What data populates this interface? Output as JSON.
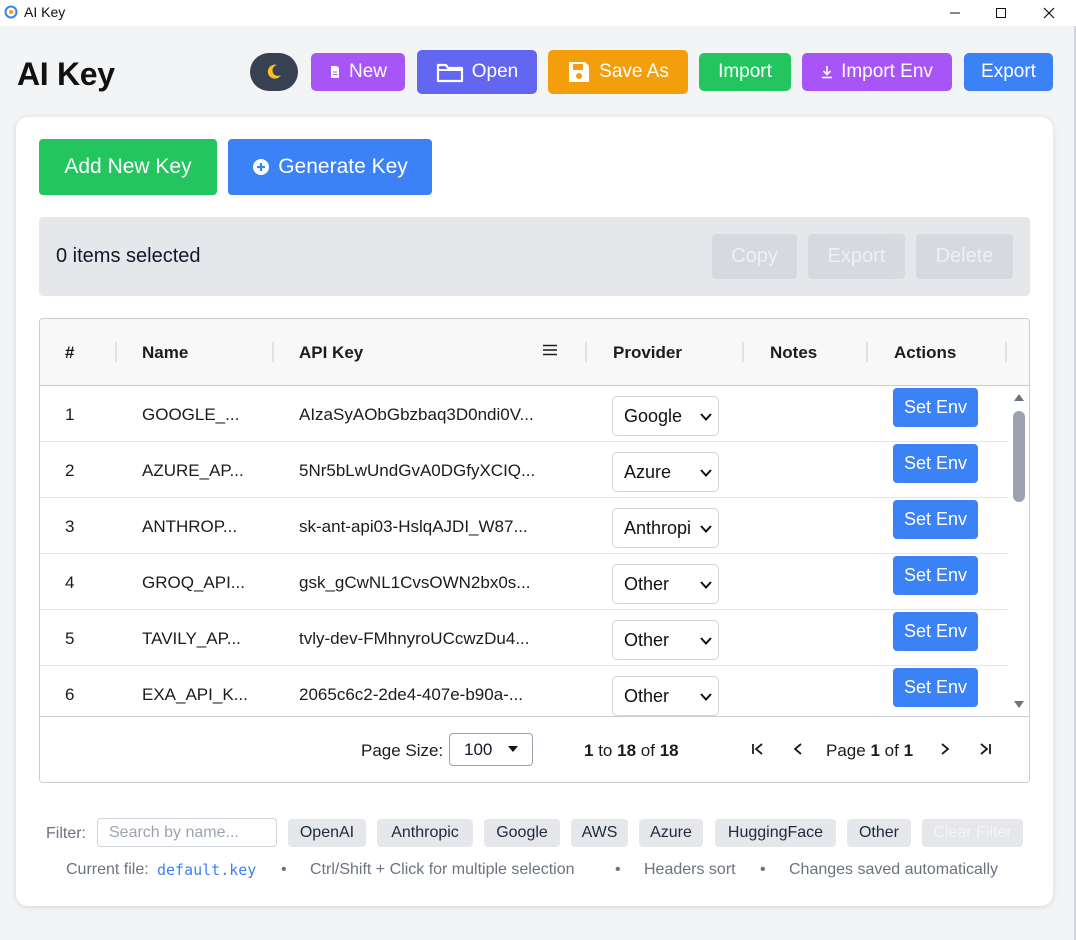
{
  "window": {
    "title": "AI Key"
  },
  "header": {
    "title": "AI Key",
    "toolbar": {
      "new_label": "New",
      "open_label": "Open",
      "save_as_label": "Save As",
      "import_label": "Import",
      "import_env_label": "Import Env",
      "export_label": "Export"
    }
  },
  "actions": {
    "add_label": "Add New Key",
    "generate_label": "Generate Key"
  },
  "selection": {
    "text": "0 items selected",
    "copy_label": "Copy",
    "export_label": "Export",
    "delete_label": "Delete"
  },
  "table": {
    "columns": [
      "#",
      "Name",
      "API Key",
      "Provider",
      "Notes",
      "Actions"
    ],
    "rows": [
      {
        "num": "1",
        "name": "GOOGLE_...",
        "key": "AIzaSyAObGbzbaq3D0ndi0V...",
        "provider": "Google",
        "notes": "",
        "action": "Set Env"
      },
      {
        "num": "2",
        "name": "AZURE_AP...",
        "key": "5Nr5bLwUndGvA0DGfyXCIQ...",
        "provider": "Azure",
        "notes": "",
        "action": "Set Env"
      },
      {
        "num": "3",
        "name": "ANTHROP...",
        "key": "sk-ant-api03-HslqAJDI_W87...",
        "provider": "Anthropic",
        "notes": "",
        "action": "Set Env"
      },
      {
        "num": "4",
        "name": "GROQ_API...",
        "key": "gsk_gCwNL1CvsOWN2bx0s...",
        "provider": "Other",
        "notes": "",
        "action": "Set Env"
      },
      {
        "num": "5",
        "name": "TAVILY_AP...",
        "key": "tvly-dev-FMhnyroUCcwzDu4...",
        "provider": "Other",
        "notes": "",
        "action": "Set Env"
      },
      {
        "num": "6",
        "name": "EXA_API_K...",
        "key": "2065c6c2-2de4-407e-b90a-...",
        "provider": "Other",
        "notes": "",
        "action": "Set Env"
      }
    ]
  },
  "pagination": {
    "page_size_label": "Page Size:",
    "page_size": "100",
    "range_from": "1",
    "range_to_word": "to",
    "range_to": "18",
    "of_word": "of",
    "total": "18",
    "page_word": "Page",
    "page": "1",
    "page_of_word": "of",
    "page_count": "1"
  },
  "filter": {
    "label": "Filter:",
    "placeholder": "Search by name...",
    "chips": [
      "OpenAI",
      "Anthropic",
      "Google",
      "AWS",
      "Azure",
      "HuggingFace",
      "Other"
    ],
    "clear_label": "Clear Filter"
  },
  "info": {
    "current_file_label": "Current file:",
    "current_file": "default.key",
    "hint_multi": "Ctrl/Shift + Click for multiple selection",
    "hint_sort": "Headers sort",
    "hint_autosave": "Changes saved automatically",
    "separator": "•"
  },
  "icons": {
    "dark_mode": "moon-icon",
    "new": "file-icon",
    "open": "folder-icon",
    "save": "floppy-icon",
    "import_env": "download-icon",
    "generate": "plus-circle-icon"
  },
  "colors": {
    "green": "#22c55e",
    "blue": "#3b82f6",
    "purple": "#a855f7",
    "indigo": "#6366f1",
    "orange": "#f59e0b",
    "dark": "#374151"
  }
}
